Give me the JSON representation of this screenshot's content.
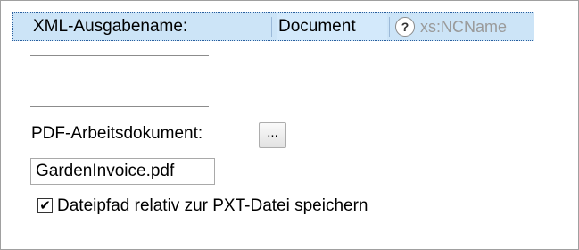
{
  "output_name": {
    "label": "XML-Ausgabename:",
    "value": "Document",
    "help_glyph": "?",
    "type_hint": "xs:NCName"
  },
  "pdf_working_document": {
    "label": "PDF-Arbeitsdokument:",
    "browse_label": "...",
    "file_name": "GardenInvoice.pdf"
  },
  "relative_path": {
    "checked": true,
    "check_glyph": "✔",
    "label": "Dateipfad relativ zur PXT-Datei speichern"
  }
}
